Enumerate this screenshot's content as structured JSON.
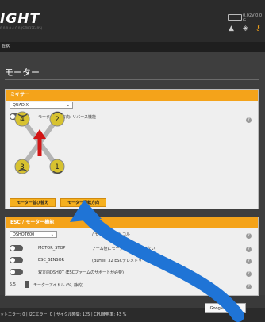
{
  "header": {
    "logo": "IGHT",
    "version_line": "0.0.0.0 4.0.0 (STM32F405)",
    "battery_text": "0.02V 0.0 G",
    "breadcrumb": "概略"
  },
  "page": {
    "title": "モーター"
  },
  "mixer": {
    "header": "ミキサー",
    "frame_type": "QUAD X",
    "reverse_label": "モーター回転方向: リバース機能",
    "motors": [
      "4",
      "2",
      "3",
      "1"
    ],
    "motor_order_button": "モーター並び替え",
    "motor_direction_button": "モーター回転方向"
  },
  "esc": {
    "header": "ESC / モーター機能",
    "protocol": "DSHOT600",
    "protocol_label": "/ モータープロトコル",
    "rows": [
      {
        "name": "MOTOR_STOP",
        "desc": "アーム後にモーターを回転させない"
      },
      {
        "name": "ESC_SENSOR",
        "desc": "(BLHeli_32 ESCテレメトリーを追加て使用"
      },
      {
        "name": "",
        "desc": "双方向DSHOT (ESCファームのサポートが必要)"
      }
    ],
    "idle_value": "5.5",
    "idle_label": "モーターアイドル (%, 静的)"
  },
  "status_bar": {
    "text": "ットエラー: 0 | I2Cエラー: 0 | サイクル時間: 125 | CPU使用率: 43 %"
  },
  "tooltip": "Google Chrome",
  "colors": {
    "accent": "#f4a31a",
    "arrow": "#1f74d6",
    "motor_badge": "#d7c230",
    "direction_arrow": "#d21515"
  }
}
